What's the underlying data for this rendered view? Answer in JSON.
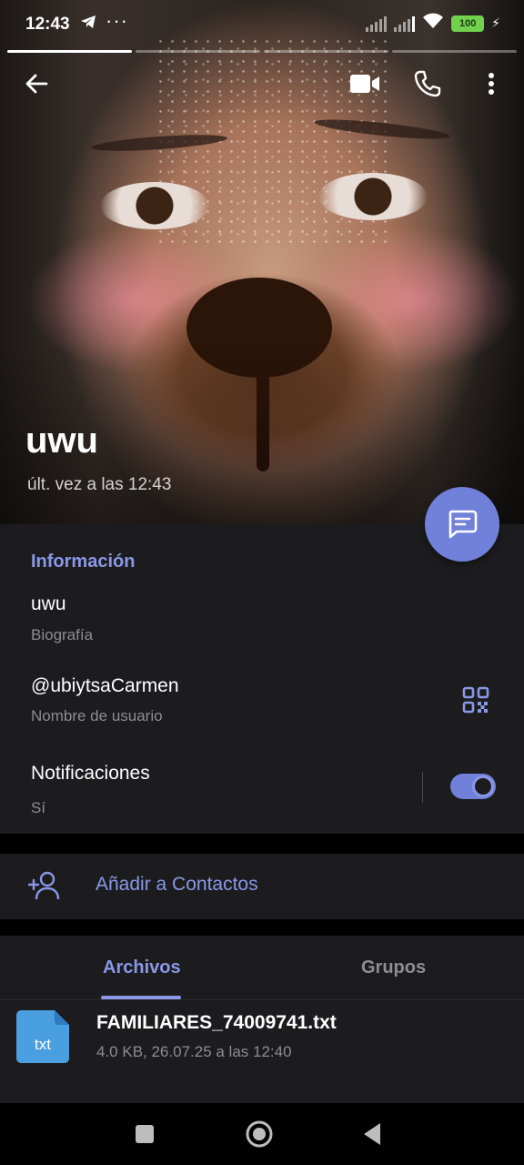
{
  "status_bar": {
    "time": "12:43",
    "battery": "100",
    "icons": [
      "telegram-icon",
      "more-notifications-icon",
      "signal-icon",
      "signal-icon",
      "wifi-icon",
      "battery-icon",
      "charging-icon"
    ]
  },
  "profile": {
    "name": "uwu",
    "last_seen": "últ. vez a las 12:43"
  },
  "info": {
    "section_title": "Información",
    "bio_value": "uwu",
    "bio_label": "Biografía",
    "username_value": "@ubiytsaCarmen",
    "username_label": "Nombre de usuario",
    "notifications_title": "Notificaciones",
    "notifications_value": "Sí"
  },
  "add_contact": {
    "label": "Añadir a Contactos"
  },
  "tabs": [
    {
      "label": "Archivos",
      "active": true
    },
    {
      "label": "Grupos",
      "active": false
    }
  ],
  "file": {
    "ext": "txt",
    "name": "FAMILIARES_74009741.txt",
    "meta": "4.0 KB, 26.07.25 a las 12:40"
  },
  "colors": {
    "accent": "#8a97e6",
    "fab": "#7180d9",
    "panel": "#1c1c1e",
    "file_icon": "#4a9fe0"
  }
}
